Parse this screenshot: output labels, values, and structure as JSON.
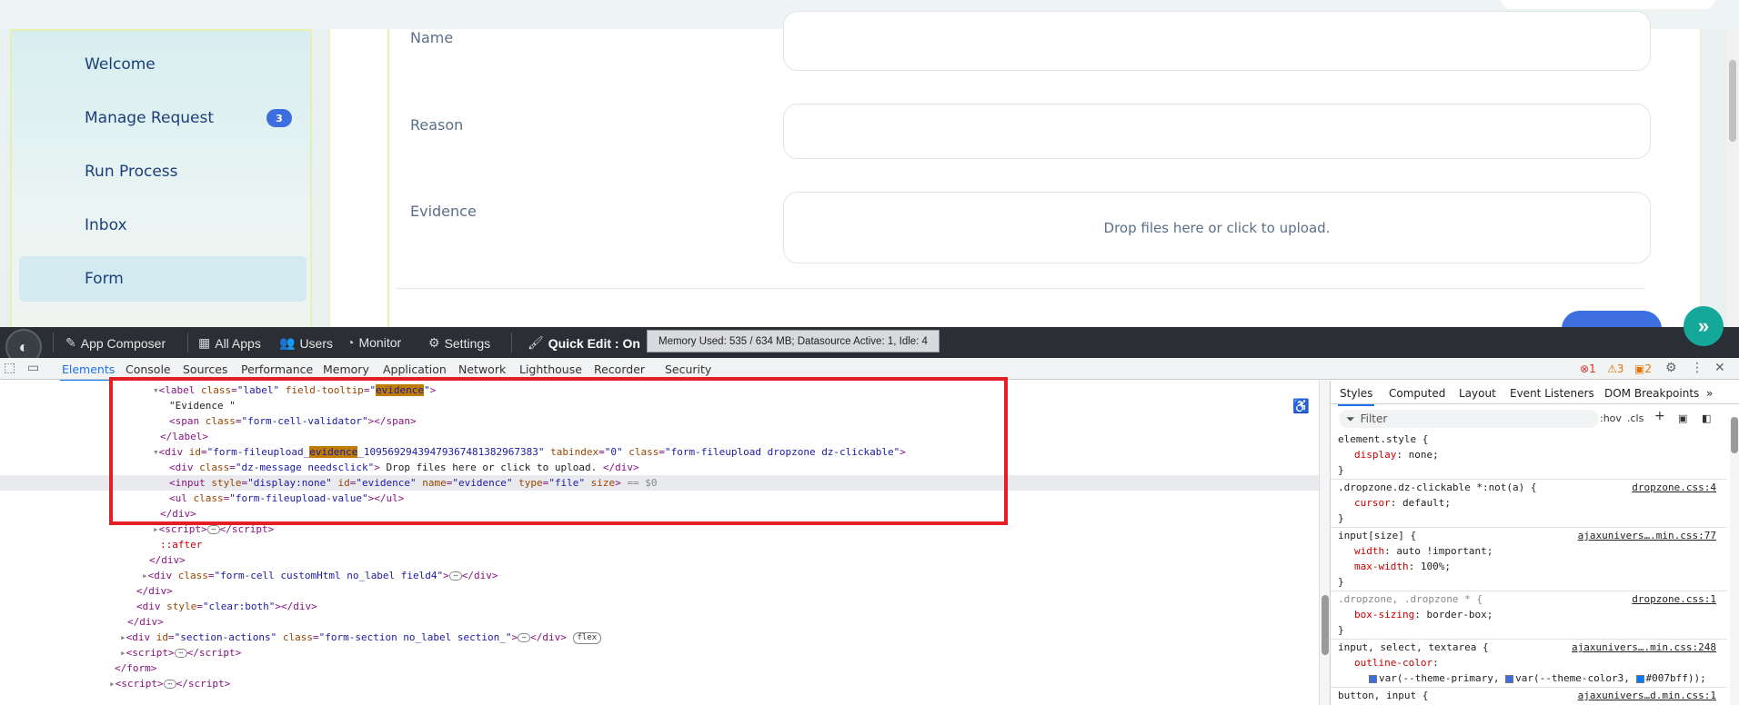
{
  "sidebar": {
    "items": [
      {
        "label": "Welcome"
      },
      {
        "label": "Manage Request",
        "badge": "3"
      },
      {
        "label": "Run Process"
      },
      {
        "label": "Inbox"
      },
      {
        "label": "Form",
        "active": true
      }
    ]
  },
  "form": {
    "name_label": "Name",
    "reason_label": "Reason",
    "evidence_label": "Evidence",
    "dropzone_text": "Drop files here or click to upload."
  },
  "toolbar": {
    "app_composer": "App Composer",
    "all_apps": "All Apps",
    "users": "Users",
    "monitor": "Monitor",
    "settings": "Settings",
    "quick_edit": "Quick Edit : On",
    "memory": "Memory Used: 535 / 634 MB; Datasource Active: 1, Idle: 4"
  },
  "devtools": {
    "tabs": [
      "Elements",
      "Console",
      "Sources",
      "Performance",
      "Memory",
      "Application",
      "Network",
      "Lighthouse",
      "Recorder",
      "Security"
    ],
    "errors": "1",
    "warnings": "3",
    "issues": "2",
    "dom_lines": [
      "label_line",
      "evidence_text",
      "span_validator",
      "label_close",
      "div_fileupload",
      "div_message",
      "input_line",
      "ul_line",
      "div_close",
      "script1",
      "after",
      "div_close2",
      "div_formcell",
      "div_close3",
      "div_clear",
      "div_close4",
      "div_section",
      "script2",
      "form_close",
      "script3"
    ],
    "dom": {
      "label_tooltip": "evidence",
      "evidence_text": "\"Evidence \"",
      "span_class": "form-cell-validator",
      "div_id_prefix": "form-fileupload_",
      "div_id_hl": "evidence",
      "div_id_suffix": "_10956929439479367481382967383",
      "div_class": "form-fileupload dropzone dz-clickable",
      "message_class": "dz-message needsclick",
      "message_text": " Drop files here or click to upload. ",
      "input_style": "display:none",
      "input_id": "evidence",
      "input_name": "evidence",
      "input_type": "file",
      "dollar": "== $0",
      "ul_class": "form-fileupload-value",
      "formcell_class": "form-cell customHtml no_label field4",
      "clear_style": "clear:both",
      "section_id": "section-actions",
      "section_class": "form-section no_label section_",
      "flex_pill": "flex"
    },
    "styles_tabs": [
      "Styles",
      "Computed",
      "Layout",
      "Event Listeners",
      "DOM Breakpoints"
    ],
    "filter_placeholder": "Filter",
    "hov": ":hov",
    "cls": ".cls",
    "rules": {
      "r1_sel": "element.style {",
      "r1_prop": "display",
      "r1_val": "none;",
      "r2_sel": ".dropzone.dz-clickable *:not(a) {",
      "r2_src": "dropzone.css:4",
      "r2_prop": "cursor",
      "r2_val": "default;",
      "r3_sel": "input[size] {",
      "r3_src": "ajaxunivers….min.css:77",
      "r3_prop1": "width",
      "r3_val1": "auto !important;",
      "r3_prop2": "max-width",
      "r3_val2": "100%;",
      "r4_sel": ".dropzone, .dropzone * {",
      "r4_src": "dropzone.css:1",
      "r4_prop": "box-sizing",
      "r4_val": "border-box;",
      "r5_sel": "input, select, textarea {",
      "r5_src": "ajaxunivers….min.css:248",
      "r5_prop": "outline-color",
      "r5_v1": "var(--theme-primary,",
      "r5_v2": "var(--theme-color3,",
      "r5_v3": "#007bff));",
      "r6_sel": "button, input {",
      "r6_src": "ajaxunivers…d.min.css:1",
      "close_brace": "}"
    }
  },
  "colors": {
    "accent": "#3d6ee0",
    "fab": "#13a89a",
    "highlight_box": "#e31e24"
  }
}
